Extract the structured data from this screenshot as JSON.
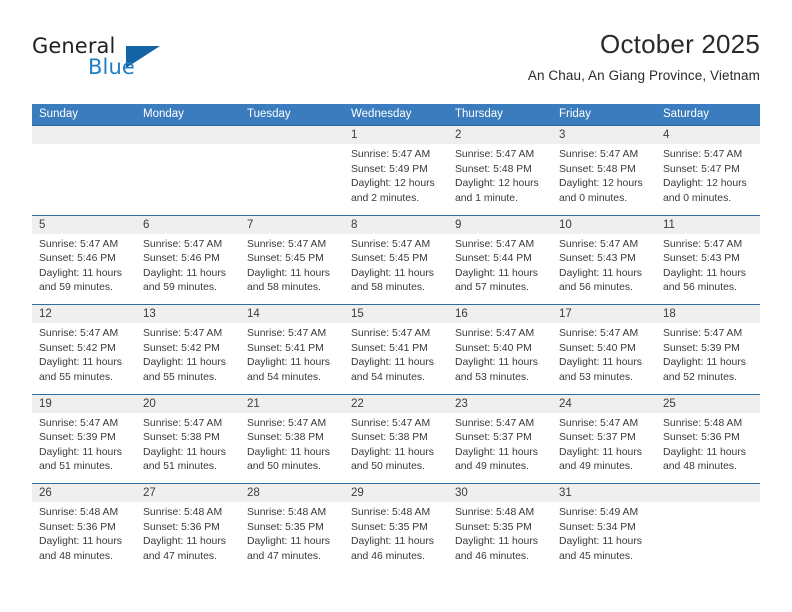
{
  "brand": {
    "name_part1": "General",
    "name_part2": "Blue",
    "triangle_color": "#1464a5",
    "blue_color": "#1f7fc4"
  },
  "header": {
    "title": "October 2025",
    "subtitle": "An Chau, An Giang Province, Vietnam"
  },
  "theme": {
    "header_bg": "#3a7cbe",
    "row_divider": "#2e6da4",
    "day_band_bg": "#efefef",
    "text": "#3a3a3a"
  },
  "weekdays": [
    "Sunday",
    "Monday",
    "Tuesday",
    "Wednesday",
    "Thursday",
    "Friday",
    "Saturday"
  ],
  "weeks": [
    [
      {
        "day": "",
        "l1": "",
        "l2": "",
        "l3": "",
        "l4": ""
      },
      {
        "day": "",
        "l1": "",
        "l2": "",
        "l3": "",
        "l4": ""
      },
      {
        "day": "",
        "l1": "",
        "l2": "",
        "l3": "",
        "l4": ""
      },
      {
        "day": "1",
        "l1": "Sunrise: 5:47 AM",
        "l2": "Sunset: 5:49 PM",
        "l3": "Daylight: 12 hours",
        "l4": "and 2 minutes."
      },
      {
        "day": "2",
        "l1": "Sunrise: 5:47 AM",
        "l2": "Sunset: 5:48 PM",
        "l3": "Daylight: 12 hours",
        "l4": "and 1 minute."
      },
      {
        "day": "3",
        "l1": "Sunrise: 5:47 AM",
        "l2": "Sunset: 5:48 PM",
        "l3": "Daylight: 12 hours",
        "l4": "and 0 minutes."
      },
      {
        "day": "4",
        "l1": "Sunrise: 5:47 AM",
        "l2": "Sunset: 5:47 PM",
        "l3": "Daylight: 12 hours",
        "l4": "and 0 minutes."
      }
    ],
    [
      {
        "day": "5",
        "l1": "Sunrise: 5:47 AM",
        "l2": "Sunset: 5:46 PM",
        "l3": "Daylight: 11 hours",
        "l4": "and 59 minutes."
      },
      {
        "day": "6",
        "l1": "Sunrise: 5:47 AM",
        "l2": "Sunset: 5:46 PM",
        "l3": "Daylight: 11 hours",
        "l4": "and 59 minutes."
      },
      {
        "day": "7",
        "l1": "Sunrise: 5:47 AM",
        "l2": "Sunset: 5:45 PM",
        "l3": "Daylight: 11 hours",
        "l4": "and 58 minutes."
      },
      {
        "day": "8",
        "l1": "Sunrise: 5:47 AM",
        "l2": "Sunset: 5:45 PM",
        "l3": "Daylight: 11 hours",
        "l4": "and 58 minutes."
      },
      {
        "day": "9",
        "l1": "Sunrise: 5:47 AM",
        "l2": "Sunset: 5:44 PM",
        "l3": "Daylight: 11 hours",
        "l4": "and 57 minutes."
      },
      {
        "day": "10",
        "l1": "Sunrise: 5:47 AM",
        "l2": "Sunset: 5:43 PM",
        "l3": "Daylight: 11 hours",
        "l4": "and 56 minutes."
      },
      {
        "day": "11",
        "l1": "Sunrise: 5:47 AM",
        "l2": "Sunset: 5:43 PM",
        "l3": "Daylight: 11 hours",
        "l4": "and 56 minutes."
      }
    ],
    [
      {
        "day": "12",
        "l1": "Sunrise: 5:47 AM",
        "l2": "Sunset: 5:42 PM",
        "l3": "Daylight: 11 hours",
        "l4": "and 55 minutes."
      },
      {
        "day": "13",
        "l1": "Sunrise: 5:47 AM",
        "l2": "Sunset: 5:42 PM",
        "l3": "Daylight: 11 hours",
        "l4": "and 55 minutes."
      },
      {
        "day": "14",
        "l1": "Sunrise: 5:47 AM",
        "l2": "Sunset: 5:41 PM",
        "l3": "Daylight: 11 hours",
        "l4": "and 54 minutes."
      },
      {
        "day": "15",
        "l1": "Sunrise: 5:47 AM",
        "l2": "Sunset: 5:41 PM",
        "l3": "Daylight: 11 hours",
        "l4": "and 54 minutes."
      },
      {
        "day": "16",
        "l1": "Sunrise: 5:47 AM",
        "l2": "Sunset: 5:40 PM",
        "l3": "Daylight: 11 hours",
        "l4": "and 53 minutes."
      },
      {
        "day": "17",
        "l1": "Sunrise: 5:47 AM",
        "l2": "Sunset: 5:40 PM",
        "l3": "Daylight: 11 hours",
        "l4": "and 53 minutes."
      },
      {
        "day": "18",
        "l1": "Sunrise: 5:47 AM",
        "l2": "Sunset: 5:39 PM",
        "l3": "Daylight: 11 hours",
        "l4": "and 52 minutes."
      }
    ],
    [
      {
        "day": "19",
        "l1": "Sunrise: 5:47 AM",
        "l2": "Sunset: 5:39 PM",
        "l3": "Daylight: 11 hours",
        "l4": "and 51 minutes."
      },
      {
        "day": "20",
        "l1": "Sunrise: 5:47 AM",
        "l2": "Sunset: 5:38 PM",
        "l3": "Daylight: 11 hours",
        "l4": "and 51 minutes."
      },
      {
        "day": "21",
        "l1": "Sunrise: 5:47 AM",
        "l2": "Sunset: 5:38 PM",
        "l3": "Daylight: 11 hours",
        "l4": "and 50 minutes."
      },
      {
        "day": "22",
        "l1": "Sunrise: 5:47 AM",
        "l2": "Sunset: 5:38 PM",
        "l3": "Daylight: 11 hours",
        "l4": "and 50 minutes."
      },
      {
        "day": "23",
        "l1": "Sunrise: 5:47 AM",
        "l2": "Sunset: 5:37 PM",
        "l3": "Daylight: 11 hours",
        "l4": "and 49 minutes."
      },
      {
        "day": "24",
        "l1": "Sunrise: 5:47 AM",
        "l2": "Sunset: 5:37 PM",
        "l3": "Daylight: 11 hours",
        "l4": "and 49 minutes."
      },
      {
        "day": "25",
        "l1": "Sunrise: 5:48 AM",
        "l2": "Sunset: 5:36 PM",
        "l3": "Daylight: 11 hours",
        "l4": "and 48 minutes."
      }
    ],
    [
      {
        "day": "26",
        "l1": "Sunrise: 5:48 AM",
        "l2": "Sunset: 5:36 PM",
        "l3": "Daylight: 11 hours",
        "l4": "and 48 minutes."
      },
      {
        "day": "27",
        "l1": "Sunrise: 5:48 AM",
        "l2": "Sunset: 5:36 PM",
        "l3": "Daylight: 11 hours",
        "l4": "and 47 minutes."
      },
      {
        "day": "28",
        "l1": "Sunrise: 5:48 AM",
        "l2": "Sunset: 5:35 PM",
        "l3": "Daylight: 11 hours",
        "l4": "and 47 minutes."
      },
      {
        "day": "29",
        "l1": "Sunrise: 5:48 AM",
        "l2": "Sunset: 5:35 PM",
        "l3": "Daylight: 11 hours",
        "l4": "and 46 minutes."
      },
      {
        "day": "30",
        "l1": "Sunrise: 5:48 AM",
        "l2": "Sunset: 5:35 PM",
        "l3": "Daylight: 11 hours",
        "l4": "and 46 minutes."
      },
      {
        "day": "31",
        "l1": "Sunrise: 5:49 AM",
        "l2": "Sunset: 5:34 PM",
        "l3": "Daylight: 11 hours",
        "l4": "and 45 minutes."
      },
      {
        "day": "",
        "l1": "",
        "l2": "",
        "l3": "",
        "l4": ""
      }
    ]
  ]
}
